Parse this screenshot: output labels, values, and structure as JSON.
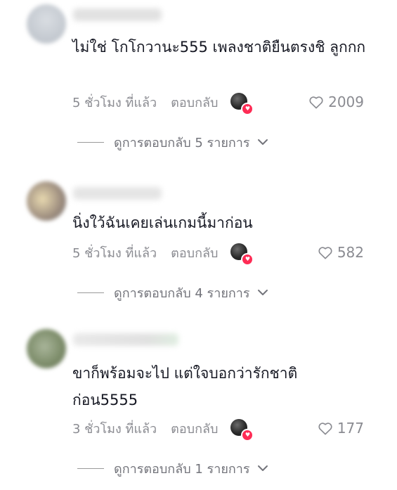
{
  "comments": [
    {
      "text": "ไม่ใช่ โกโกวานะ555 เพลงชาติยืนตรงชิ ลูกกก",
      "time": "5 ชั่วโมง ที่แล้ว",
      "reply_label": "ตอบกลับ",
      "likes": "2009",
      "view_replies": "ดูการตอบกลับ 5 รายการ"
    },
    {
      "text": "นิ่งใว้ฉันเคยเล่นเกมนี้มาก่อน",
      "time": "5 ชั่วโมง ที่แล้ว",
      "reply_label": "ตอบกลับ",
      "likes": "582",
      "view_replies": "ดูการตอบกลับ 4 รายการ"
    },
    {
      "text": "ขาก็พร้อมจะไป แต่ใจบอกว่ารักชาติก่อน5555",
      "time": "3 ชั่วโมง ที่แล้ว",
      "reply_label": "ตอบกลับ",
      "likes": "177",
      "view_replies": "ดูการตอบกลับ 1 รายการ"
    }
  ],
  "colors": {
    "text": "#161823",
    "muted": "#8a8b91",
    "creator_heart": "#fe2c55"
  },
  "icons": [
    "heart-outline-icon",
    "chevron-down-icon",
    "creator-liked-heart-icon"
  ]
}
